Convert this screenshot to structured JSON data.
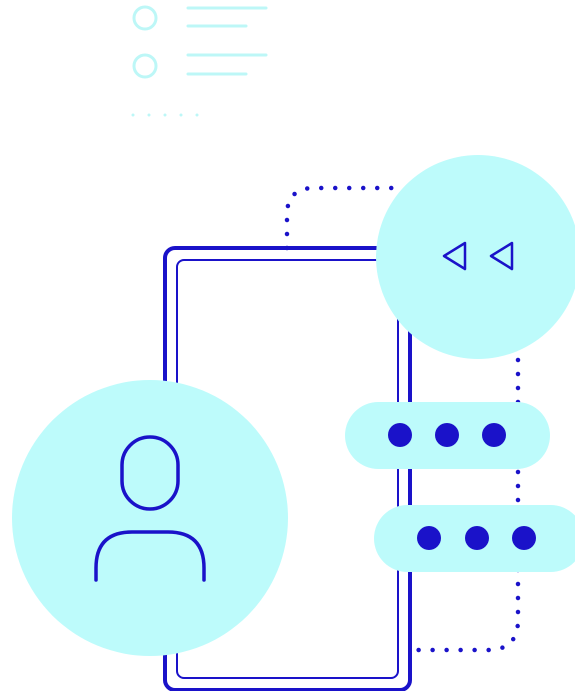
{
  "icons": {
    "checklist": "checklist-icon",
    "phone": "smartphone-icon",
    "user": "user-avatar-icon",
    "back": "rewind-icon",
    "chat_top": "typing-bubble-icon",
    "chat_bottom": "typing-bubble-icon"
  },
  "colors": {
    "background": "#ffffff",
    "primary": "#1a12c9",
    "accent_light": "#bdfbfb",
    "checklist": "#bdf7f7"
  }
}
